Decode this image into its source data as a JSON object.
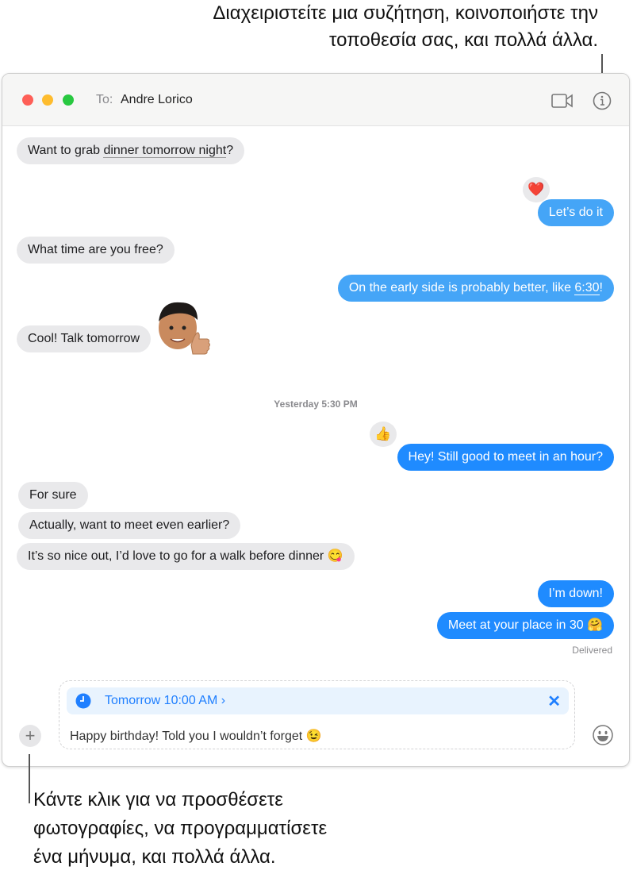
{
  "callouts": {
    "top_line1": "Διαχειριστείτε μια συζήτηση, κοινοποιήστε την",
    "top_line2": "τοποθεσία σας, και πολλά άλλα.",
    "bottom_line1": "Κάντε κλικ για να προσθέσετε",
    "bottom_line2": "φωτογραφίες, να προγραμματίσετε",
    "bottom_line3": "ένα μήνυμα, και πολλά άλλα."
  },
  "header": {
    "to_label": "To:",
    "recipient": "Andre Lorico"
  },
  "colors": {
    "sent": "#1f8bff",
    "sent_light": "#45a5f7",
    "received": "#e9e9eb",
    "schedule_bg": "#e8f3fe"
  },
  "messages": [
    {
      "pre": "Want to grab ",
      "link": "dinner tomorrow night",
      "post": "?"
    },
    {
      "text": "Let’s do it",
      "tapback": "❤️"
    },
    {
      "text": "What time are you free?"
    },
    {
      "pre": "On the early side is probably better, like ",
      "link": "6:30",
      "post": "!"
    },
    {
      "text": "Cool! Talk tomorrow",
      "sticker": "memoji-thumbs-up"
    },
    {
      "text": "Hey! Still good to meet in an hour?",
      "tapback": "👍"
    },
    {
      "text": "For sure"
    },
    {
      "text": "Actually, want to meet even earlier?"
    },
    {
      "text": "It’s so nice out, I’d love to go for a walk before dinner 😋"
    },
    {
      "text": "I’m down!"
    },
    {
      "text": "Meet at your place in 30 🤗"
    }
  ],
  "timestamp": "Yesterday 5:30 PM",
  "status": "Delivered",
  "compose": {
    "schedule": "Tomorrow 10:00 AM",
    "schedule_chevron": "›",
    "text": "Happy birthday! Told you I wouldn’t forget 😉"
  },
  "icons": {
    "video": "video-camera-icon",
    "info": "info-icon",
    "add": "plus-icon",
    "emoji": "emoji-icon",
    "clock": "clock-icon",
    "close": "close-icon"
  }
}
